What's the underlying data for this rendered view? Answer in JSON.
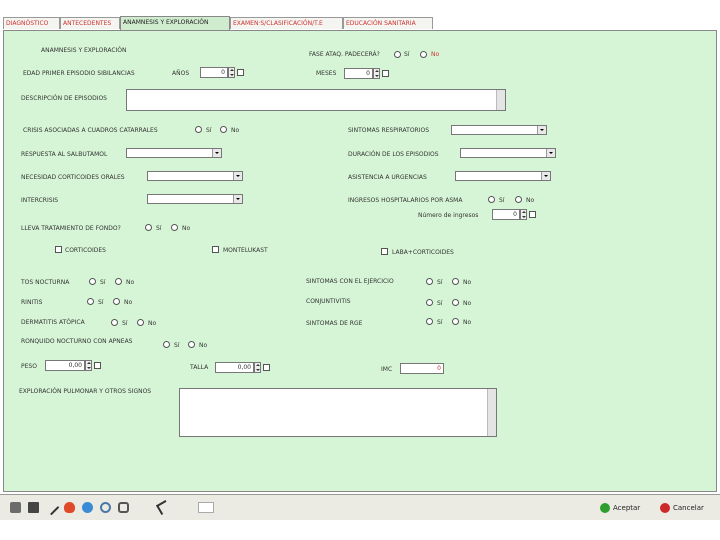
{
  "tabs": [
    "DIAGNÓSTICO",
    "ANTECEDENTES",
    "ANAMNESIS Y EXPLORACIÓN",
    "EXAMEN·S/CLASIFICACIÓN/T.E",
    "EDUCACIÓN SANITARIA"
  ],
  "form": {
    "title": "ANAMNESIS Y EXPLORACIÓN",
    "edad_label": "EDAD PRIMER EPISODIO SIBILANCIAS",
    "anos_label": "AÑOS",
    "anos_value": "0",
    "meses_label": "MESES",
    "meses_value": "0",
    "fase_label": "FASE ATAQ. PADECERÁ?",
    "desc_label": "DESCRIPCIÓN DE EPISODIOS",
    "crisis_label": "CRISIS ASOCIADAS A CUADROS CATARRALES",
    "sintomas_resp_label": "SINTOMAS RESPIRATORIOS",
    "respuesta_label": "RESPUESTA AL SALBUTAMOL",
    "duracion_label": "DURACIÓN DE LOS EPISODIOS",
    "necesidad_label": "NECESIDAD CORTICOIDES ORALES",
    "asistencia_label": "ASISTENCIA A URGENCIAS",
    "intercrisis_label": "INTERCRISIS",
    "ingresos_label": "INGRESOS HOSPITALARIOS POR ASMA",
    "numero_ingresos_label": "Número de ingresos",
    "numero_ingresos_value": "0",
    "tratamiento_label": "LLEVA TRATAMIENTO DE FONDO?",
    "corticoides_label": "CORTICOIDES",
    "montelukast_label": "MONTELUKAST",
    "laba_label": "LABA+CORTICOIDES",
    "tos_label": "TOS NOCTURNA",
    "rinitis_label": "RINITIS",
    "dermatitis_label": "DERMATITIS ATÓPICA",
    "ronquido_label": "RONQUIDO NOCTURNO CON APNEAS",
    "ejercicio_label": "SINTOMAS CON EL EJERCICIO",
    "conjuntivitis_label": "CONJUNTIVITIS",
    "rge_label": "SINTOMAS DE RGE",
    "peso_label": "PESO",
    "peso_value": "0,00",
    "talla_label": "TALLA",
    "talla_value": "0,00",
    "imc_label": "IMC",
    "imc_value": "0",
    "exploracion_label": "EXPLORACIÓN PULMONAR Y OTROS SIGNOS",
    "si": "Sí",
    "no": "No"
  },
  "toolbar": {
    "aceptar": "Aceptar",
    "cancelar": "Cancelar"
  }
}
